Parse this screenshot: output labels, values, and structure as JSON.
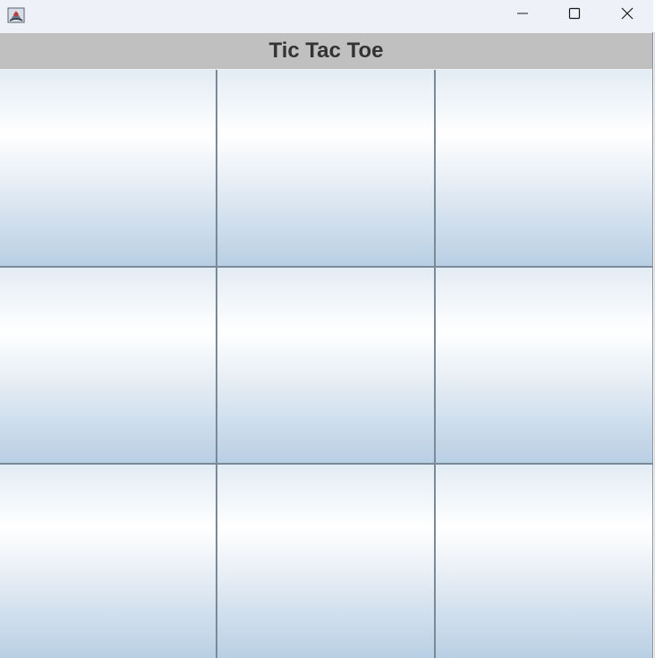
{
  "window": {
    "minimize_glyph": "—",
    "maximize_glyph": "☐",
    "close_glyph": "✕"
  },
  "header": {
    "title": "Tic Tac Toe"
  },
  "board": {
    "cells": [
      "",
      "",
      "",
      "",
      "",
      "",
      "",
      "",
      ""
    ]
  },
  "icons": {
    "app": "java-app-icon",
    "minimize": "minimize-icon",
    "maximize": "maximize-icon",
    "close": "close-icon"
  },
  "colors": {
    "header_background": "#c0c0c0",
    "title_text": "#333333",
    "cell_gradient_top": "#e3ecf4",
    "cell_gradient_light": "#ffffff",
    "cell_gradient_bottom": "#b8cfe4",
    "grid_line": "#7a8a99"
  }
}
